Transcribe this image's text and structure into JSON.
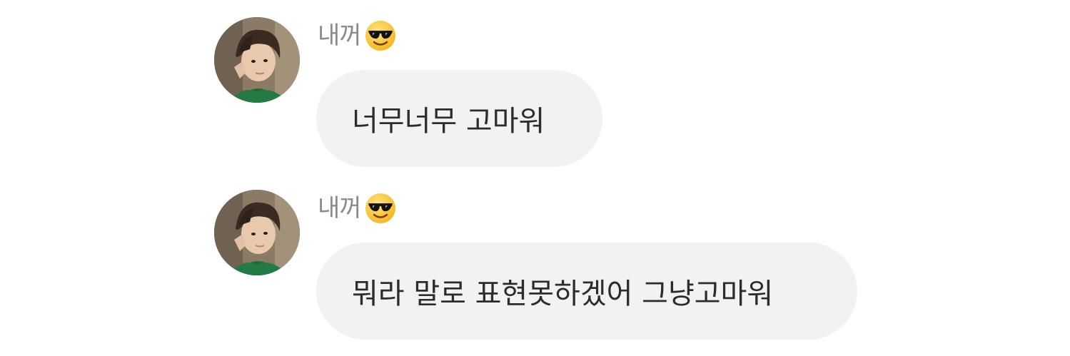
{
  "messages": [
    {
      "sender": "내꺼",
      "sender_emoji": "smiling-face-with-sunglasses",
      "text": "너무너무 고마워"
    },
    {
      "sender": "내꺼",
      "sender_emoji": "smiling-face-with-sunglasses",
      "text": "뭐라 말로 표현못하겠어 그냥고마워"
    }
  ],
  "colors": {
    "bubble_background": "#f2f2f5",
    "message_text": "#2c2c2e",
    "sender_text": "#8a8a8f",
    "page_background": "#ffffff"
  }
}
